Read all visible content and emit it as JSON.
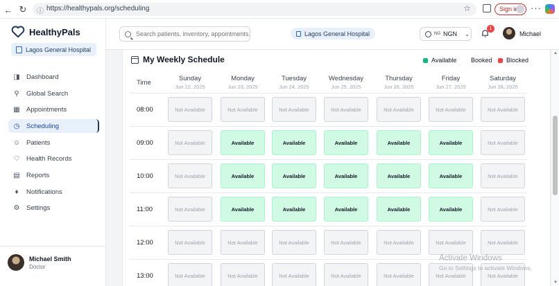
{
  "browser": {
    "url": "https://healthypals.org/scheduling",
    "sign_in": "Sign in",
    "menu": "···"
  },
  "sidebar": {
    "app_name": "HealthyPals",
    "hospital": "Lagos General Hospital",
    "items": [
      {
        "label": "Dashboard",
        "icon": "dashboard-icon",
        "active": false
      },
      {
        "label": "Global Search",
        "icon": "search-icon",
        "active": false
      },
      {
        "label": "Appointments",
        "icon": "calendar-icon",
        "active": false
      },
      {
        "label": "Scheduling",
        "icon": "clock-icon",
        "active": true
      },
      {
        "label": "Patients",
        "icon": "users-icon",
        "active": false
      },
      {
        "label": "Health Records",
        "icon": "heart-icon",
        "active": false
      },
      {
        "label": "Reports",
        "icon": "file-icon",
        "active": false
      },
      {
        "label": "Notifications",
        "icon": "bell-icon",
        "active": false
      },
      {
        "label": "Settings",
        "icon": "gear-icon",
        "active": false
      }
    ],
    "user": {
      "name": "Michael Smith",
      "role": "Doctor"
    }
  },
  "header": {
    "search_placeholder": "Search patients, inventory, appointments...",
    "hospital": "Lagos General Hospital",
    "currency_flag": "NG",
    "currency": "NGN",
    "notification_count": "1",
    "user_name": "Michael"
  },
  "schedule": {
    "title": "My Weekly Schedule",
    "legend": [
      {
        "label": "Available",
        "color": "#10b981"
      },
      {
        "label": "Booked",
        "color": "#2563eb"
      },
      {
        "label": "Blocked",
        "color": "#ef4444"
      }
    ],
    "time_header": "Time",
    "days": [
      {
        "name": "Sunday",
        "date": "Jun 22, 2025"
      },
      {
        "name": "Monday",
        "date": "Jun 23, 2025"
      },
      {
        "name": "Tuesday",
        "date": "Jun 24, 2025"
      },
      {
        "name": "Wednesday",
        "date": "Jun 25, 2025"
      },
      {
        "name": "Thursday",
        "date": "Jun 26, 2025"
      },
      {
        "name": "Friday",
        "date": "Jun 27, 2025"
      },
      {
        "name": "Saturday",
        "date": "Jun 28, 2025"
      }
    ],
    "rows": [
      {
        "time": "08:00",
        "slots": [
          "Not Available",
          "Not Available",
          "Not Available",
          "Not Available",
          "Not Available",
          "Not Available",
          "Not Available"
        ]
      },
      {
        "time": "09:00",
        "slots": [
          "Not Available",
          "Available",
          "Available",
          "Available",
          "Available",
          "Available",
          "Not Available"
        ]
      },
      {
        "time": "10:00",
        "slots": [
          "Not Available",
          "Available",
          "Available",
          "Available",
          "Available",
          "Available",
          "Not Available"
        ]
      },
      {
        "time": "11:00",
        "slots": [
          "Not Available",
          "Available",
          "Available",
          "Available",
          "Available",
          "Available",
          "Not Available"
        ]
      },
      {
        "time": "12:00",
        "slots": [
          "Not Available",
          "Not Available",
          "Not Available",
          "Not Available",
          "Not Available",
          "Not Available",
          "Not Available"
        ]
      },
      {
        "time": "13:00",
        "slots": [
          "Not Available",
          "Not Available",
          "Not Available",
          "Not Available",
          "Not Available",
          "Not Available",
          "Not Available"
        ]
      }
    ]
  },
  "watermark": {
    "title": "Activate Windows",
    "subtitle": "Go to Settings to activate Windows."
  }
}
